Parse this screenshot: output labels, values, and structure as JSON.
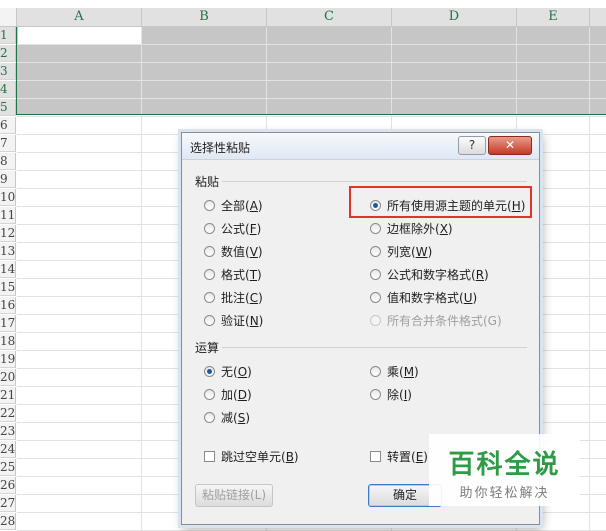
{
  "spreadsheet": {
    "columns": [
      "A",
      "B",
      "C",
      "D",
      "E"
    ],
    "rows": [
      "1",
      "2",
      "3",
      "4",
      "5",
      "6",
      "7",
      "8",
      "9",
      "10",
      "11",
      "12",
      "13",
      "14",
      "15",
      "16",
      "17",
      "18",
      "19",
      "20",
      "21",
      "22",
      "23",
      "24",
      "25",
      "26",
      "27",
      "28"
    ],
    "selection_color": "#217346"
  },
  "dialog": {
    "title": "选择性粘贴",
    "help_label": "?",
    "close_label": "✕",
    "paste_section": "粘贴",
    "paste_options": {
      "all": {
        "text": "全部(",
        "key": "A"
      },
      "formulas": {
        "text": "公式(",
        "key": "F"
      },
      "values": {
        "text": "数值(",
        "key": "V"
      },
      "formats": {
        "text": "格式(",
        "key": "T"
      },
      "comments": {
        "text": "批注(",
        "key": "C"
      },
      "validation": {
        "text": "验证(",
        "key": "N"
      },
      "source_theme": {
        "text": "所有使用源主题的单元(",
        "key": "H"
      },
      "no_borders": {
        "text": "边框除外(",
        "key": "X"
      },
      "col_widths": {
        "text": "列宽(",
        "key": "W"
      },
      "formula_num": {
        "text": "公式和数字格式(",
        "key": "R"
      },
      "value_num": {
        "text": "值和数字格式(",
        "key": "U"
      },
      "merge_cond": {
        "text": "所有合并条件格式(G)"
      }
    },
    "operation_section": "运算",
    "operation_options": {
      "none": {
        "text": "无(",
        "key": "O"
      },
      "add": {
        "text": "加(",
        "key": "D"
      },
      "subtract": {
        "text": "减(",
        "key": "S"
      },
      "multiply": {
        "text": "乘(",
        "key": "M"
      },
      "divide": {
        "text": "除(",
        "key": "I"
      }
    },
    "skip_blanks": {
      "text": "跳过空单元(",
      "key": "B"
    },
    "transpose": {
      "text": "转置(",
      "key": "E"
    },
    "paste_link_label": "粘贴链接(L)",
    "ok_label": "确定",
    "highlight_color": "#e03428"
  },
  "watermark": {
    "title": "百科全说",
    "subtitle": "助你轻松解决"
  }
}
